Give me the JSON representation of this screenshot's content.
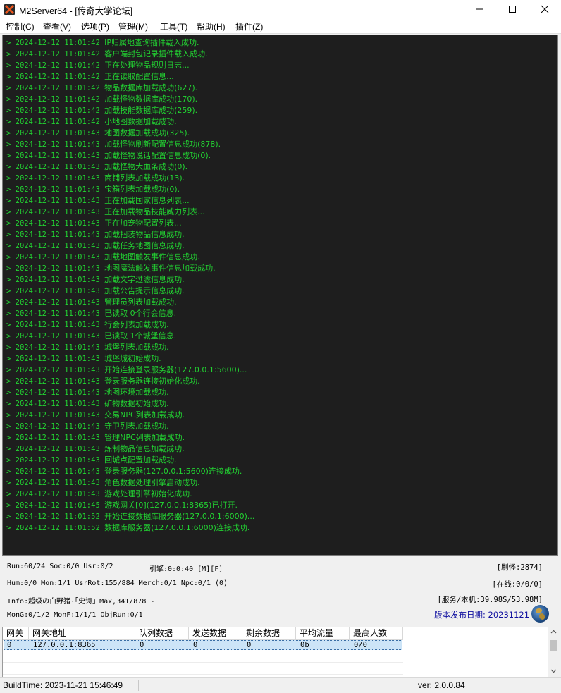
{
  "window": {
    "title": "M2Server64 - [传奇大学论坛]"
  },
  "menu": [
    "控制(C)",
    "查看(V)",
    "选项(P)",
    "管理(M)",
    "工具(T)",
    "帮助(H)",
    "插件(Z)"
  ],
  "log": [
    {
      "time": "2024-12-12 11:01:42",
      "msg": "IP归属地查询插件载入成功."
    },
    {
      "time": "2024-12-12 11:01:42",
      "msg": "客户端封包记录插件载入成功."
    },
    {
      "time": "2024-12-12 11:01:42",
      "msg": "正在处理物品规则日志..."
    },
    {
      "time": "2024-12-12 11:01:42",
      "msg": "正在读取配置信息..."
    },
    {
      "time": "2024-12-12 11:01:42",
      "msg": "物品数据库加载成功(627)."
    },
    {
      "time": "2024-12-12 11:01:42",
      "msg": "加载怪物数据库成功(170)."
    },
    {
      "time": "2024-12-12 11:01:42",
      "msg": "加载技能数据库成功(259)."
    },
    {
      "time": "2024-12-12 11:01:42",
      "msg": "小地图数据加载成功."
    },
    {
      "time": "2024-12-12 11:01:43",
      "msg": "地图数据加载成功(325)."
    },
    {
      "time": "2024-12-12 11:01:43",
      "msg": "加载怪物刷新配置信息成功(878)."
    },
    {
      "time": "2024-12-12 11:01:43",
      "msg": "加载怪物说话配置信息成功(0)."
    },
    {
      "time": "2024-12-12 11:01:43",
      "msg": "加载怪物大血条成功(0)."
    },
    {
      "time": "2024-12-12 11:01:43",
      "msg": "商铺列表加载成功(13)."
    },
    {
      "time": "2024-12-12 11:01:43",
      "msg": "宝箱列表加载成功(0)."
    },
    {
      "time": "2024-12-12 11:01:43",
      "msg": "正在加载国家信息列表..."
    },
    {
      "time": "2024-12-12 11:01:43",
      "msg": "正在加载物品技能威力列表..."
    },
    {
      "time": "2024-12-12 11:01:43",
      "msg": "正在加宠物配置列表..."
    },
    {
      "time": "2024-12-12 11:01:43",
      "msg": "加载捆装物品信息成功."
    },
    {
      "time": "2024-12-12 11:01:43",
      "msg": "加载任务地图信息成功."
    },
    {
      "time": "2024-12-12 11:01:43",
      "msg": "加载地图触发事件信息成功."
    },
    {
      "time": "2024-12-12 11:01:43",
      "msg": "地图魔法触发事件信息加载成功."
    },
    {
      "time": "2024-12-12 11:01:43",
      "msg": "加载文字过滤信息成功."
    },
    {
      "time": "2024-12-12 11:01:43",
      "msg": "加载公告提示信息成功."
    },
    {
      "time": "2024-12-12 11:01:43",
      "msg": "管理员列表加载成功."
    },
    {
      "time": "2024-12-12 11:01:43",
      "msg": "已读取 0个行会信息."
    },
    {
      "time": "2024-12-12 11:01:43",
      "msg": "行会列表加载成功."
    },
    {
      "time": "2024-12-12 11:01:43",
      "msg": "已读取 1个城堡信息."
    },
    {
      "time": "2024-12-12 11:01:43",
      "msg": "城堡列表加载成功."
    },
    {
      "time": "2024-12-12 11:01:43",
      "msg": "城堡城初始成功."
    },
    {
      "time": "2024-12-12 11:01:43",
      "msg": "开始连接登录服务器(127.0.0.1:5600)..."
    },
    {
      "time": "2024-12-12 11:01:43",
      "msg": "登录服务器连接初始化成功."
    },
    {
      "time": "2024-12-12 11:01:43",
      "msg": "地图环境加载成功."
    },
    {
      "time": "2024-12-12 11:01:43",
      "msg": "矿物数据初始成功."
    },
    {
      "time": "2024-12-12 11:01:43",
      "msg": "交易NPC列表加载成功."
    },
    {
      "time": "2024-12-12 11:01:43",
      "msg": "守卫列表加载成功."
    },
    {
      "time": "2024-12-12 11:01:43",
      "msg": "管理NPC列表加载成功."
    },
    {
      "time": "2024-12-12 11:01:43",
      "msg": "炼制物品信息加载成功."
    },
    {
      "time": "2024-12-12 11:01:43",
      "msg": "回城点配置加载成功."
    },
    {
      "time": "2024-12-12 11:01:43",
      "msg": "登录服务器(127.0.0.1:5600)连接成功."
    },
    {
      "time": "2024-12-12 11:01:43",
      "msg": "角色数据处理引擎启动成功."
    },
    {
      "time": "2024-12-12 11:01:43",
      "msg": "游戏处理引擎初始化成功."
    },
    {
      "time": "2024-12-12 11:01:45",
      "msg": "游戏网关[0](127.0.0.1:8365)已打开."
    },
    {
      "time": "2024-12-12 11:01:52",
      "msg": "开始连接数据库服务器(127.0.0.1:6000)..."
    },
    {
      "time": "2024-12-12 11:01:52",
      "msg": "数据库服务器(127.0.0.1:6000)连接成功."
    }
  ],
  "log_prompt": ">",
  "stats": {
    "line1": "Run:60/24 Soc:0/0 Usr:0/2",
    "engine": "引擎:0:0:40 [M][F]",
    "line2": "Hum:0/0 Mon:1/1 UsrRot:155/884 Merch:0/1 Npc:0/1 (0)",
    "line3": "Info:超级の白野猪·「史诗」Max,341/878 -",
    "line4": "MonG:0/1/2 MonF:1/1/1 ObjRun:0/1",
    "refresh": "[刷怪:2874]",
    "online": "[在线:0/0/0]",
    "memory": "[服务/本机:39.98S/53.98M]",
    "release_date": "版本发布日期: 20231121"
  },
  "gateway_table": {
    "headers": [
      "网关",
      "网关地址",
      "队列数据",
      "发送数据",
      "剩余数据",
      "平均流量",
      "最高人数"
    ],
    "rows": [
      [
        "0",
        "127.0.0.1:8365",
        "0",
        "0",
        "0",
        "0b",
        "0/0"
      ]
    ]
  },
  "statusbar": {
    "build_time": "BuildTime: 2023-11-21 15:46:49",
    "version": "ver: 2.0.0.84"
  },
  "colors": {
    "log_bg": "#1e1e1e",
    "log_text": "#22d332",
    "release_text": "#1010a0",
    "row_selected": "#cce4f7"
  }
}
